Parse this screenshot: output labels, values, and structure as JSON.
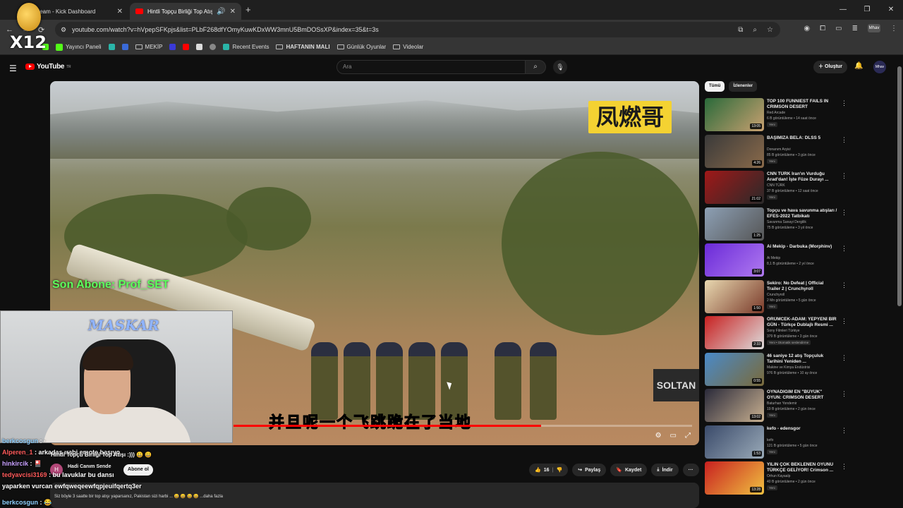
{
  "browser": {
    "tabs": [
      {
        "label": "Stream - Kick Dashboard"
      },
      {
        "label": "Hintli Topçu Birliği Top Atışı"
      }
    ],
    "url": "youtube.com/watch?v=hVpepSFKpjs&list=PLbF268dfYOmyKuwKDxWW3mnU5BmDOSsXP&index=35&t=3s",
    "bookmarks": [
      {
        "label": "Yayıncı Paneli",
        "icon": "kick-icon"
      },
      {
        "label": "MEKİP",
        "icon": "folder-icon"
      },
      {
        "label": "Recent Events",
        "icon": "streamelements-icon"
      },
      {
        "label": "HAFTANIN MALI",
        "icon": "folder-icon"
      },
      {
        "label": "Günlük Oyunlar",
        "icon": "folder-icon"
      },
      {
        "label": "Videolar",
        "icon": "folder-icon"
      }
    ],
    "overlay_multiplier": "X12"
  },
  "youtube": {
    "logo": "YouTube",
    "logo_country": "TR",
    "search_placeholder": "Ara",
    "create_label": "Oluştur",
    "account_label": "Mhav"
  },
  "video": {
    "logo_text": "凤燃哥",
    "subtitle": "并且呢一个飞跳跪在了当地",
    "sign_text": "SOLTAN",
    "progress_fraction": 0.67,
    "overlay_last_sub": "Son Abone: Prof_SET"
  },
  "webcam": {
    "label": "MASKAR"
  },
  "chat": [
    {
      "user": "berkcosgun",
      "msg": ": ·",
      "color": "#8fd0ff"
    },
    {
      "user": "Alperen_1",
      "msg": ": arkadaş ırabi emote basıyo",
      "color": "#ff5a5a"
    },
    {
      "user": "hinkircik",
      "msg": ": 🎴",
      "color": "#c8a0ff"
    },
    {
      "user": "tedyavcisi3169",
      "msg": ": bu lavuklar bu dansı",
      "color": "#ff5a5a"
    },
    {
      "user": "yaparken vurcan",
      "msg": "ewfqweqeewfqpjeuifqertq3er",
      "color": "#ffffff"
    },
    {
      "user": "berkcosgun",
      "msg": ": 😂",
      "color": "#8fd0ff"
    }
  ],
  "chat_overlay_line": "Hintli Topçu Birliği Top Atışı :)))  😀 😀",
  "channel": {
    "initial": "H",
    "name": "Hadi Canım Sende",
    "subscribe_label": "Abone ol"
  },
  "actions": {
    "likes": "16",
    "share": "Paylaş",
    "save": "Kaydet",
    "download": "İndir",
    "more": "···"
  },
  "description": "Siz böyle 3 saatte bir top atışı yaparsanız, Pakistan sizi harbi ... 😀 😀 😀 😀 ...daha fazla",
  "filters": [
    {
      "label": "Tümü",
      "active": true
    },
    {
      "label": "İzlenenler",
      "active": false
    }
  ],
  "recommendations": [
    {
      "title": "TOP 100 FUNNIEST FAILS IN CRIMSON DESERT",
      "channel": "Red Arcade",
      "meta": "6 B görüntüleme • 14 saat önce",
      "badge": "Yeni",
      "duration": "13:05",
      "color1": "#2a6a3a",
      "color2": "#c8a070"
    },
    {
      "title": "BAŞIMIZA BELA: DLSS 5",
      "channel": "Donanım Arşivi",
      "meta": "85 B görüntüleme • 3 gün önce",
      "badge": "Yeni",
      "duration": "4:26",
      "color1": "#3a3a3a",
      "color2": "#8a6a4a"
    },
    {
      "title": "CNN TÜRK İran'ın Vurduğu Arad'dan! İşte Füze Durayı ...",
      "channel": "CNN TÜRK",
      "meta": "37 B görüntüleme • 12 saat önce",
      "badge": "Yeni",
      "duration": "21:02",
      "color1": "#a01818",
      "color2": "#2a2a2a"
    },
    {
      "title": "Topçu ve hava savunma atışları / EFES-2022 Tatbikatı",
      "channel": "Savunma Sanayi Dergilik",
      "meta": "75 B görüntüleme • 3 yıl önce",
      "badge": "",
      "duration": "1:25",
      "color1": "#8da0b5",
      "color2": "#555"
    },
    {
      "title": "Ai Mekip - Darbuka (Morphinv)",
      "channel": "Ai Mekip",
      "meta": "8,1 B görüntüleme • 2 yıl önce",
      "badge": "",
      "duration": "3:07",
      "color1": "#6a2ad8",
      "color2": "#b07af0"
    },
    {
      "title": "Sekiro: No Defeat | Official Trailer 2 | Crunchyroll",
      "channel": "Crunchyroll",
      "meta": "2 Mn görüntüleme • 5 gün önce",
      "badge": "Yeni",
      "duration": "1:50",
      "color1": "#e8d8b0",
      "color2": "#7a3a2a"
    },
    {
      "title": "ÖRÜMCEK-ADAM: YEPYENİ BİR GÜN - Türkçe Dublajlı Resmi ...",
      "channel": "Sony Filmleri Türkiye",
      "meta": "379 B görüntüleme • 3 gün önce",
      "badge": "Yeni • Otomatik seslendirme",
      "duration": "2:33",
      "color1": "#c82020",
      "color2": "#ddd"
    },
    {
      "title": "46 saniye 12 atış Topçuluk Tarihini Yeniden ...",
      "channel": "Makine ve Kimya Endüstrisi",
      "meta": "976 B görüntüleme • 10 ay önce",
      "badge": "",
      "duration": "0:55",
      "color1": "#4a8ac8",
      "color2": "#7a6a3a"
    },
    {
      "title": "OYNADIĞIM EN \"BÜYÜK\" OYUN: CRIMSON DESERT ALINIR MI?",
      "channel": "Baturhan Yondemir",
      "meta": "19 B görüntüleme • 2 gün önce",
      "badge": "Yeni",
      "duration": "13:02",
      "color1": "#2a2a3a",
      "color2": "#c8b090"
    },
    {
      "title": "kefo - edensgor",
      "channel": "kefo",
      "meta": "121 B görüntüleme • 5 gün önce",
      "badge": "Yeni",
      "duration": "1:53",
      "color1": "#3a4a6a",
      "color2": "#9aaab8"
    },
    {
      "title": "YILIN ÇOK BEKLENEN OYUNU TÜRKÇE GELİYOR! Crimson ...",
      "channel": "Orhun Kayaalp",
      "meta": "40 B görüntüleme • 2 gün önce",
      "badge": "Yeni",
      "duration": "13:28",
      "color1": "#c82020",
      "color2": "#f0c040"
    }
  ]
}
